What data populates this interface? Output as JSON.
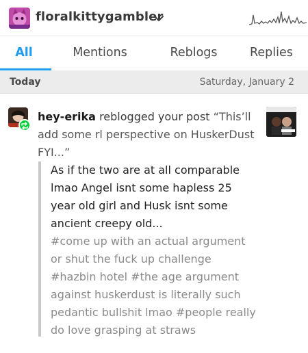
{
  "header": {
    "blog_name": "floralkittygambler",
    "dropdown_icon": "chevron-down-icon",
    "activity_icon": "activity-graph-icon"
  },
  "tabs": [
    {
      "label": "All",
      "active": true
    },
    {
      "label": "Mentions",
      "active": false
    },
    {
      "label": "Reblogs",
      "active": false
    },
    {
      "label": "Replies",
      "active": false
    }
  ],
  "section": {
    "label": "Today",
    "date": "Saturday, January 2"
  },
  "notification": {
    "username": "hey-erika",
    "action": " reblogged your post ",
    "post_title": "“This’ll add some rl perspective on HuskerDust FYI...”",
    "body": "As if the two are at all comparable lmao Angel isnt some hapless 25 year old girl and Husk isnt some ancient creepy old...",
    "tags": "#come up with an actual argument or shut the fuck up challenge #hazbin hotel #the age argument against huskerdust is literally such pedantic bullshit lmao #people really do love grasping at straws",
    "badge_icon": "reblog-icon"
  },
  "colors": {
    "accent": "#1d9bf0",
    "reblog_green": "#00cf35",
    "section_bg": "#ececec"
  }
}
